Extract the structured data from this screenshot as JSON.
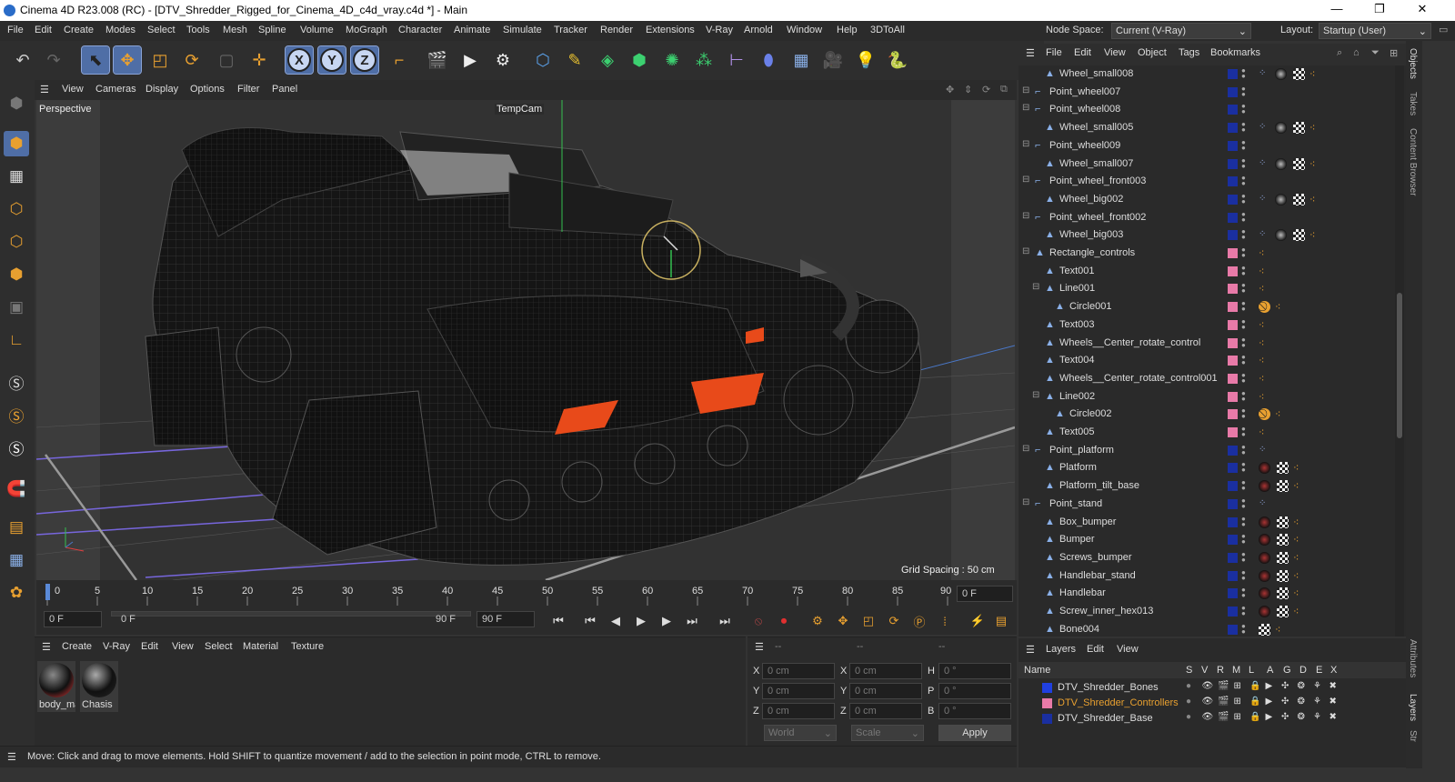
{
  "window": {
    "title": "Cinema 4D R23.008 (RC) - [DTV_Shredder_Rigged_for_Cinema_4D_c4d_vray.c4d *] - Main",
    "controls": [
      "—",
      "❐",
      "✕"
    ]
  },
  "menu": [
    "File",
    "Edit",
    "Create",
    "Modes",
    "Select",
    "Tools",
    "Mesh",
    "Spline",
    "Volume",
    "MoGraph",
    "Character",
    "Animate",
    "Simulate",
    "Tracker",
    "Render",
    "Extensions",
    "V-Ray",
    "Arnold",
    "Window",
    "Help",
    "3DToAll"
  ],
  "node_space": {
    "label": "Node Space:",
    "value": "Current (V-Ray)"
  },
  "layout": {
    "label": "Layout:",
    "value": "Startup (User)"
  },
  "viewport": {
    "menu": [
      "View",
      "Cameras",
      "Display",
      "Options",
      "Filter",
      "Panel"
    ],
    "label": "Perspective",
    "camera": "TempCam",
    "grid_spacing": "Grid Spacing : 50 cm"
  },
  "timeline": {
    "ticks": [
      "0",
      "5",
      "10",
      "15",
      "20",
      "25",
      "30",
      "35",
      "40",
      "45",
      "50",
      "55",
      "60",
      "65",
      "70",
      "75",
      "80",
      "85",
      "90"
    ],
    "current_frame": "0 F"
  },
  "transport": {
    "start": "0 F",
    "range_start": "0 F",
    "range_end": "90 F",
    "end": "90 F"
  },
  "material_manager": {
    "menu": [
      "Create",
      "V-Ray",
      "Edit",
      "View",
      "Select",
      "Material",
      "Texture"
    ],
    "materials": [
      "body_ma",
      "Chasis"
    ]
  },
  "coordinates": {
    "header": [
      "--",
      "--",
      "--"
    ],
    "rows": [
      {
        "a": "X",
        "av": "0 cm",
        "b": "X",
        "bv": "0 cm",
        "c": "H",
        "cv": "0 °"
      },
      {
        "a": "Y",
        "av": "0 cm",
        "b": "Y",
        "bv": "0 cm",
        "c": "P",
        "cv": "0 °"
      },
      {
        "a": "Z",
        "av": "0 cm",
        "b": "Z",
        "bv": "0 cm",
        "c": "B",
        "cv": "0 °"
      }
    ],
    "world": "World",
    "scale": "Scale",
    "apply": "Apply"
  },
  "status": "Move: Click and drag to move elements. Hold SHIFT to quantize movement / add to the selection in point mode, CTRL to remove.",
  "object_manager": {
    "menu": [
      "File",
      "Edit",
      "View",
      "Object",
      "Tags",
      "Bookmarks"
    ],
    "rows": [
      {
        "name": "Wheel_small008",
        "level": 1,
        "layer": "#1a2fa0",
        "tags": "wheel"
      },
      {
        "name": "Point_wheel007",
        "level": 0,
        "layer": "#1a2fa0",
        "tags": ""
      },
      {
        "name": "Point_wheel008",
        "level": 0,
        "layer": "#1a2fa0",
        "tags": ""
      },
      {
        "name": "Wheel_small005",
        "level": 1,
        "layer": "#1a2fa0",
        "tags": "wheel"
      },
      {
        "name": "Point_wheel009",
        "level": 0,
        "layer": "#1a2fa0",
        "tags": ""
      },
      {
        "name": "Wheel_small007",
        "level": 1,
        "layer": "#1a2fa0",
        "tags": "wheel"
      },
      {
        "name": "Point_wheel_front003",
        "level": 0,
        "layer": "#1a2fa0",
        "tags": ""
      },
      {
        "name": "Wheel_big002",
        "level": 1,
        "layer": "#1a2fa0",
        "tags": "wheel"
      },
      {
        "name": "Point_wheel_front002",
        "level": 0,
        "layer": "#1a2fa0",
        "tags": ""
      },
      {
        "name": "Wheel_big003",
        "level": 1,
        "layer": "#1a2fa0",
        "tags": "wheel"
      },
      {
        "name": "Rectangle_controls",
        "level": 0,
        "layer": "#e87aa8",
        "tags": "dots"
      },
      {
        "name": "Text001",
        "level": 1,
        "layer": "#e87aa8",
        "tags": "dots"
      },
      {
        "name": "Line001",
        "level": 1,
        "layer": "#e87aa8",
        "tags": "dots"
      },
      {
        "name": "Circle001",
        "level": 2,
        "layer": "#e87aa8",
        "tags": "noentry"
      },
      {
        "name": "Text003",
        "level": 1,
        "layer": "#e87aa8",
        "tags": "dots"
      },
      {
        "name": "Wheels__Center_rotate_control",
        "level": 1,
        "layer": "#e87aa8",
        "tags": "dots"
      },
      {
        "name": "Text004",
        "level": 1,
        "layer": "#e87aa8",
        "tags": "dots"
      },
      {
        "name": "Wheels__Center_rotate_control001",
        "level": 1,
        "layer": "#e87aa8",
        "tags": "dots"
      },
      {
        "name": "Line002",
        "level": 1,
        "layer": "#e87aa8",
        "tags": "dots"
      },
      {
        "name": "Circle002",
        "level": 2,
        "layer": "#e87aa8",
        "tags": "noentry"
      },
      {
        "name": "Text005",
        "level": 1,
        "layer": "#e87aa8",
        "tags": "dots"
      },
      {
        "name": "Point_platform",
        "level": 0,
        "layer": "#1a2fa0",
        "tags": "rig"
      },
      {
        "name": "Platform",
        "level": 1,
        "layer": "#1a2fa0",
        "tags": "mat"
      },
      {
        "name": "Platform_tilt_base",
        "level": 1,
        "layer": "#1a2fa0",
        "tags": "mat"
      },
      {
        "name": "Point_stand",
        "level": 0,
        "layer": "#1a2fa0",
        "tags": "rig"
      },
      {
        "name": "Box_bumper",
        "level": 1,
        "layer": "#1a2fa0",
        "tags": "mat"
      },
      {
        "name": "Bumper",
        "level": 1,
        "layer": "#1a2fa0",
        "tags": "mat"
      },
      {
        "name": "Screws_bumper",
        "level": 1,
        "layer": "#1a2fa0",
        "tags": "mat"
      },
      {
        "name": "Handlebar_stand",
        "level": 1,
        "layer": "#1a2fa0",
        "tags": "mat"
      },
      {
        "name": "Handlebar",
        "level": 1,
        "layer": "#1a2fa0",
        "tags": "mat"
      },
      {
        "name": "Screw_inner_hex013",
        "level": 1,
        "layer": "#1a2fa0",
        "tags": "mat"
      },
      {
        "name": "Bone004",
        "level": 1,
        "layer": "#1a2fa0",
        "tags": "bone"
      }
    ]
  },
  "layers": {
    "menu": [
      "Layers",
      "Edit",
      "View"
    ],
    "columns": [
      "Name",
      "S",
      "V",
      "R",
      "M",
      "L",
      "A",
      "G",
      "D",
      "E",
      "X"
    ],
    "rows": [
      {
        "name": "DTV_Shredder_Bones",
        "color": "#2040e0",
        "active": false
      },
      {
        "name": "DTV_Shredder_Controllers",
        "color": "#e87aa8",
        "active": true
      },
      {
        "name": "DTV_Shredder_Base",
        "color": "#1a2fa0",
        "active": false
      }
    ]
  },
  "right_tabs": [
    "Objects",
    "Takes",
    "Content Browser",
    "Attributes",
    "Layers",
    "Str"
  ]
}
